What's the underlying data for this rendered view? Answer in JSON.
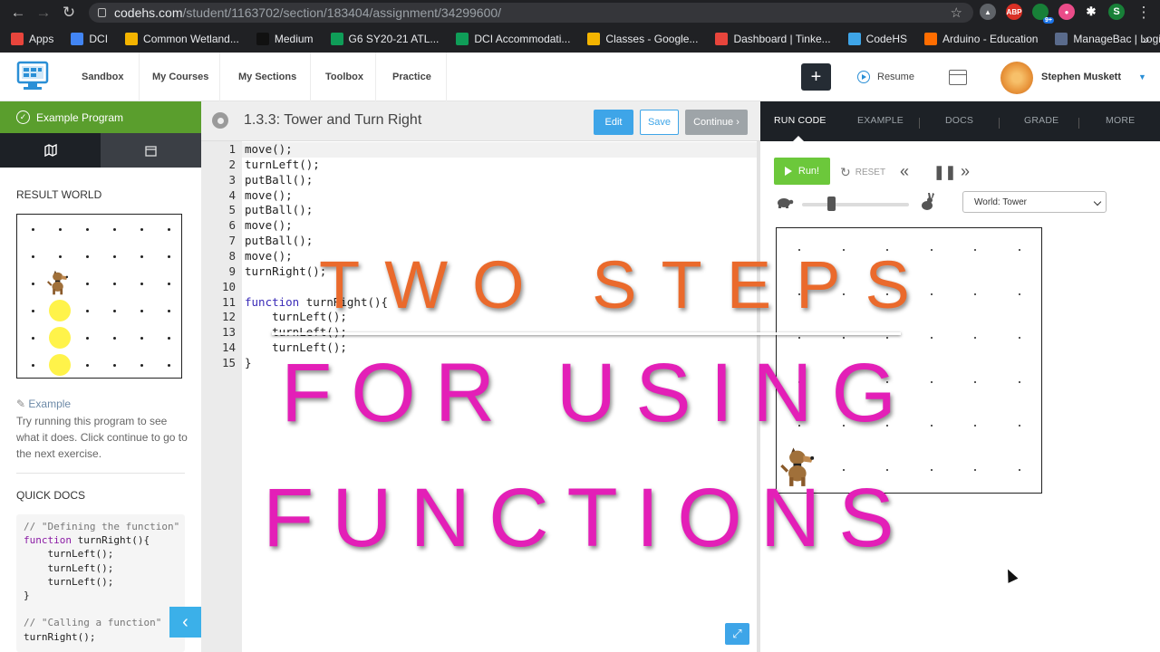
{
  "browser": {
    "url_host": "codehs.com",
    "url_path": "/student/1163702/section/183404/assignment/34299600/",
    "extension_badge": "9+",
    "profile_letter": "S",
    "bookmarks": [
      {
        "label": "Apps",
        "color": "#e8453c"
      },
      {
        "label": "DCI",
        "color": "#4285f4"
      },
      {
        "label": "Common Wetland...",
        "color": "#f4b400"
      },
      {
        "label": "Medium",
        "color": "#111111"
      },
      {
        "label": "G6 SY20-21 ATL...",
        "color": "#0f9d58"
      },
      {
        "label": "DCI Accommodati...",
        "color": "#0f9d58"
      },
      {
        "label": "Classes - Google...",
        "color": "#f4b400"
      },
      {
        "label": "Dashboard | Tinke...",
        "color": "#e8453c"
      },
      {
        "label": "CodeHS",
        "color": "#3ea5e8"
      },
      {
        "label": "Arduino - Education",
        "color": "#ff6d00"
      },
      {
        "label": "ManageBac | Login",
        "color": "#5a6b8c"
      }
    ]
  },
  "header": {
    "nav": [
      "Sandbox",
      "My Courses",
      "My Sections",
      "Toolbox",
      "Practice"
    ],
    "plus": "+",
    "resume": "Resume",
    "user_name": "Stephen Muskett"
  },
  "left_panel": {
    "program_label": "Example Program",
    "result_world_title": "RESULT WORLD",
    "example_link": "Example",
    "example_text": "Try running this program to see what it does. Click continue to go to the next exercise.",
    "quick_docs_title": "QUICK DOCS",
    "quick_docs_code": [
      {
        "text": "// \"Defining the function\"",
        "cls": "cm"
      },
      {
        "text": "function turnRight(){",
        "cls": "fn"
      },
      {
        "text": "    turnLeft();",
        "cls": ""
      },
      {
        "text": "    turnLeft();",
        "cls": ""
      },
      {
        "text": "    turnLeft();",
        "cls": ""
      },
      {
        "text": "}",
        "cls": ""
      },
      {
        "text": "",
        "cls": ""
      },
      {
        "text": "// \"Calling a function\"",
        "cls": "cm"
      },
      {
        "text": "turnRight();",
        "cls": ""
      }
    ],
    "collapse_glyph": "‹"
  },
  "editor": {
    "title": "1.3.3: Tower and Turn Right",
    "edit_label": "Edit",
    "save_label": "Save",
    "continue_label": "Continue ›",
    "lines": [
      "move();",
      "turnLeft();",
      "putBall();",
      "move();",
      "putBall();",
      "move();",
      "putBall();",
      "move();",
      "turnRight();",
      "",
      "function turnRight(){",
      "    turnLeft();",
      "    turnLeft();",
      "    turnLeft();",
      "}"
    ],
    "expand_glyph": "⤢"
  },
  "run_panel": {
    "tabs": [
      "RUN CODE",
      "EXAMPLE",
      "DOCS",
      "GRADE",
      "MORE"
    ],
    "run_label": "Run!",
    "reset_label": "RESET",
    "world_select": "World: Tower",
    "speed_fraction": 0.27
  },
  "overlay": {
    "line1": "TWO STEPS",
    "line2": "FOR USING",
    "line3": "FUNCTIONS"
  },
  "colors": {
    "green": "#5a9e2d",
    "blue": "#3ea5e8",
    "dark": "#1d2126",
    "ball": "#fff34a",
    "title_orange": "#ea6a2c",
    "title_magenta": "#e31fb7"
  }
}
